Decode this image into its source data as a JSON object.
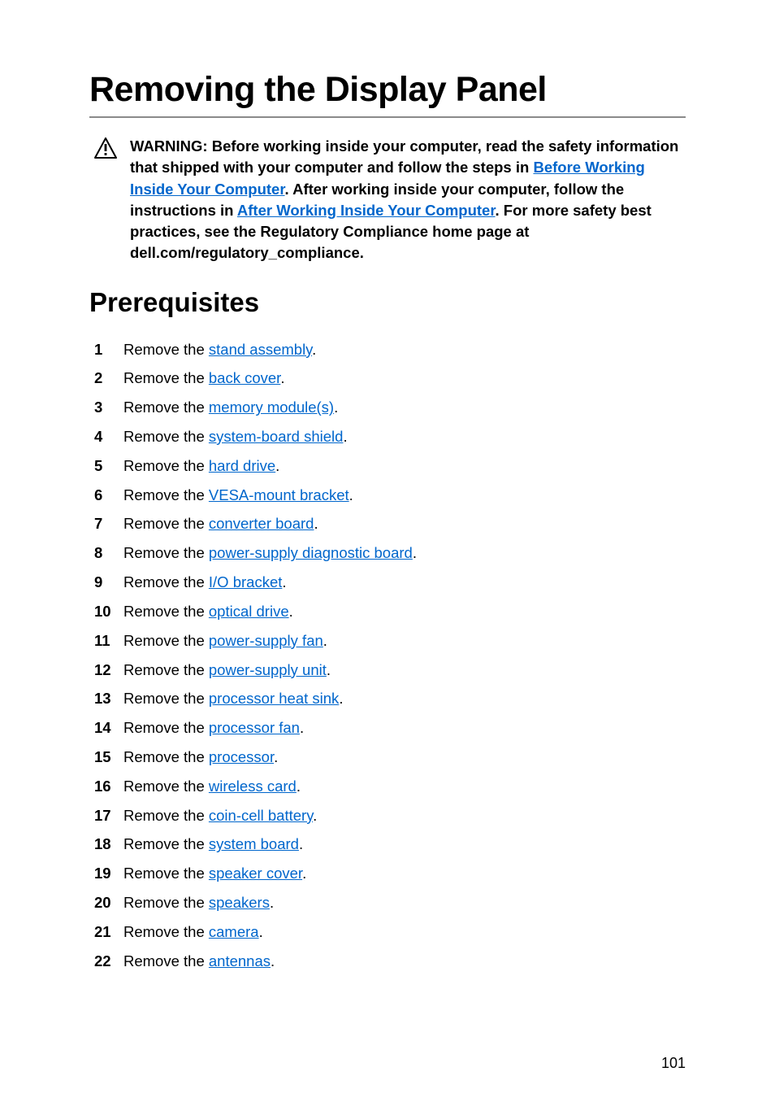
{
  "title": "Removing the Display Panel",
  "warning": {
    "prefix": "WARNING: Before working inside your computer, read the safety information that shipped with your computer and follow the steps in ",
    "link1": "Before Working Inside Your Computer",
    "mid1": ". After working inside your computer, follow the instructions in ",
    "link2": "After Working Inside Your Computer",
    "suffix": ". For more safety best practices, see the Regulatory Compliance home page at dell.com/regulatory_compliance."
  },
  "section_heading": "Prerequisites",
  "remove_prefix": "Remove the ",
  "period": ".",
  "items": [
    {
      "n": "1",
      "link": "stand assembly"
    },
    {
      "n": "2",
      "link": "back cover"
    },
    {
      "n": "3",
      "link": "memory module(s)"
    },
    {
      "n": "4",
      "link": "system-board shield"
    },
    {
      "n": "5",
      "link": "hard drive"
    },
    {
      "n": "6",
      "link": "VESA-mount bracket"
    },
    {
      "n": "7",
      "link": "converter board"
    },
    {
      "n": "8",
      "link": "power-supply diagnostic board"
    },
    {
      "n": "9",
      "link": "I/O bracket"
    },
    {
      "n": "10",
      "link": "optical drive"
    },
    {
      "n": "11",
      "link": "power-supply fan"
    },
    {
      "n": "12",
      "link": "power-supply unit"
    },
    {
      "n": "13",
      "link": "processor heat sink"
    },
    {
      "n": "14",
      "link": "processor fan"
    },
    {
      "n": "15",
      "link": "processor"
    },
    {
      "n": "16",
      "link": "wireless card"
    },
    {
      "n": "17",
      "link": "coin-cell battery"
    },
    {
      "n": "18",
      "link": "system board"
    },
    {
      "n": "19",
      "link": "speaker cover"
    },
    {
      "n": "20",
      "link": "speakers"
    },
    {
      "n": "21",
      "link": "camera"
    },
    {
      "n": "22",
      "link": "antennas"
    }
  ],
  "page_number": "101"
}
